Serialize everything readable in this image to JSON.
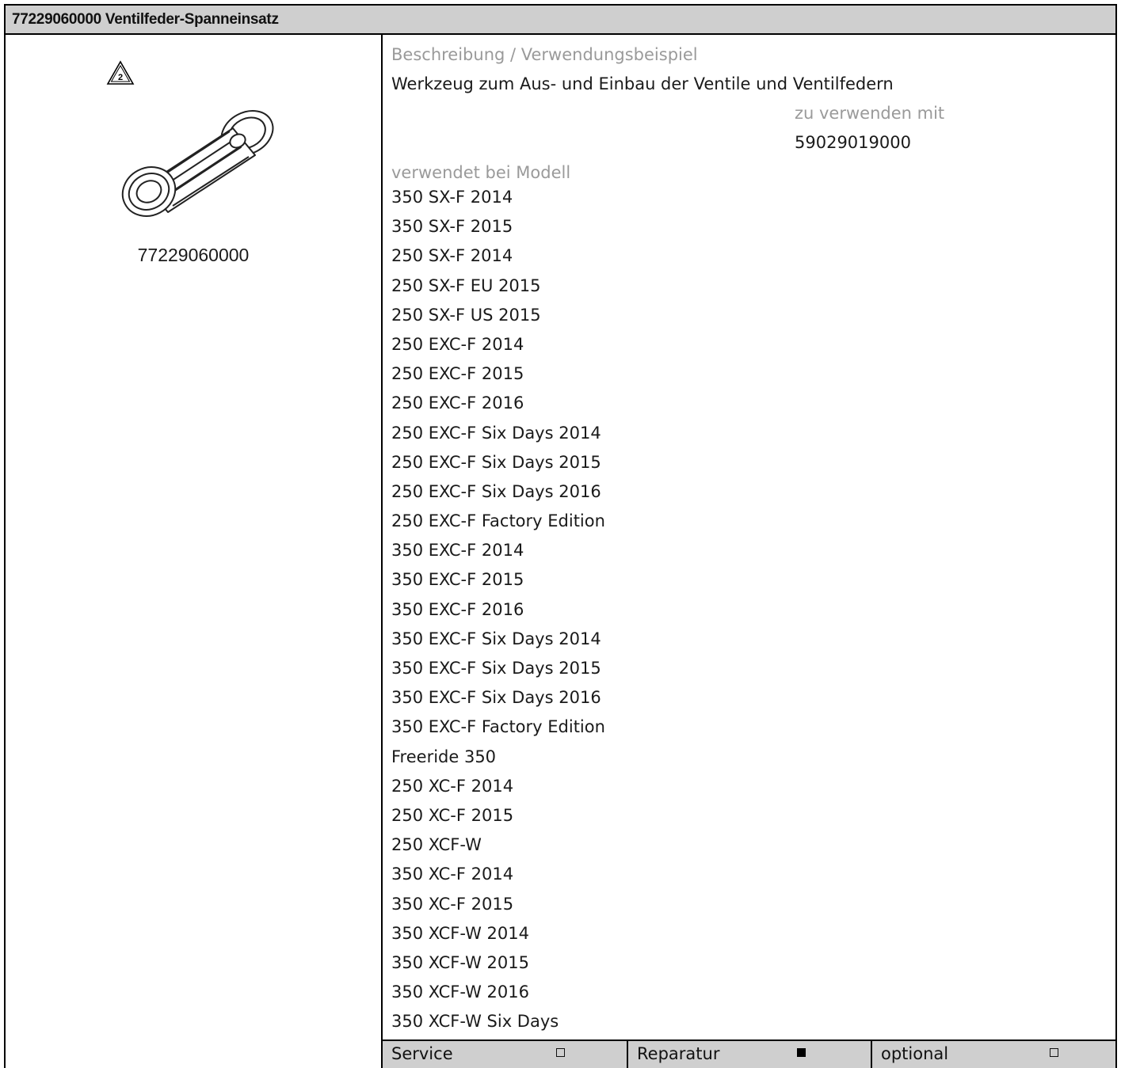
{
  "header": {
    "title": "77229060000 Ventilfeder-Spanneinsatz"
  },
  "left": {
    "warning_icon": "warning-triangle-2-icon",
    "warning_number": "2",
    "part_number": "77229060000"
  },
  "description": {
    "heading": "Beschreibung / Verwendungsbeispiel",
    "text": "Werkzeug zum Aus- und Einbau der Ventile und Ventilfedern",
    "use_with_label": "zu verwenden mit",
    "use_with_value": "59029019000"
  },
  "models": {
    "heading": "verwendet bei Modell",
    "items": [
      "350 SX-F 2014",
      "350 SX-F 2015",
      "250 SX-F 2014",
      "250 SX-F EU 2015",
      "250 SX-F US 2015",
      "250 EXC-F 2014",
      "250 EXC-F 2015",
      "250 EXC-F 2016",
      "250 EXC-F Six Days 2014",
      "250 EXC-F Six Days 2015",
      "250 EXC-F Six Days 2016",
      "250 EXC-F Factory Edition",
      "350 EXC-F 2014",
      "350 EXC-F 2015",
      "350 EXC-F 2016",
      "350 EXC-F Six Days 2014",
      "350 EXC-F Six Days 2015",
      "350 EXC-F Six Days 2016",
      "350 EXC-F Factory Edition",
      "Freeride 350",
      "250 XC-F 2014",
      "250 XC-F 2015",
      "250 XCF-W",
      "350 XC-F 2014",
      "350 XC-F 2015",
      "350 XCF-W 2014",
      "350 XCF-W 2015",
      "350 XCF-W 2016",
      "350 XCF-W Six Days"
    ]
  },
  "footer": {
    "service_label": "Service",
    "service_checked": false,
    "reparatur_label": "Reparatur",
    "reparatur_checked": true,
    "optional_label": "optional",
    "optional_checked": false
  }
}
